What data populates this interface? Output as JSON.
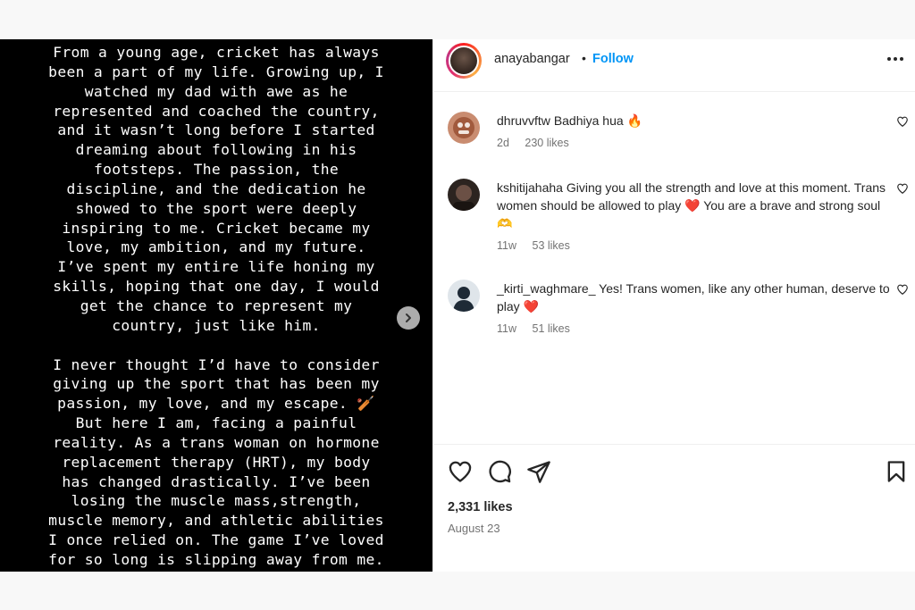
{
  "media": {
    "paragraph1": "From a young age, cricket has always\nbeen a part of my life. Growing up, I\nwatched my dad with awe as he\nrepresented and coached the country,\nand it wasn’t long before I started\ndreaming about following in his\nfootsteps. The passion, the\ndiscipline, and the dedication he\nshowed to the sport were deeply\ninspiring to me. Cricket became my\nlove, my ambition, and my future.\nI’ve spent my entire life honing my\nskills, hoping that one day, I would\nget the chance to represent my\ncountry, just like him.",
    "paragraph2": "I never thought I’d have to consider\ngiving up the sport that has been my\npassion, my love, and my escape. 🏏\nBut here I am, facing a painful\nreality. As a trans woman on hormone\nreplacement therapy (HRT), my body\nhas changed drastically. I’ve been\nlosing the muscle mass,strength,\nmuscle memory, and athletic abilities\nI once relied on. The game I’ve loved\nfor so long is slipping away from me.",
    "next_icon": "chevron-right-icon"
  },
  "header": {
    "username": "anayabangar",
    "separator": "•",
    "follow_label": "Follow",
    "more_icon": "more-horizontal-icon"
  },
  "comments": [
    {
      "username": "dhruvvftw",
      "text": "Badhiya hua 🔥",
      "age": "2d",
      "likes": "230 likes",
      "avatar_color": "#b56a4a"
    },
    {
      "username": "kshitijahaha",
      "text": "Giving you all the strength and love at this moment. Trans women should be allowed to play ❤️ You are a brave and strong soul 🫶",
      "age": "11w",
      "likes": "53 likes",
      "avatar_color": "#3b2f2a"
    },
    {
      "username": "_kirti_waghmare_",
      "text": "Yes! Trans women, like any other human, deserve to play ❤️",
      "age": "11w",
      "likes": "51 likes",
      "avatar_color": "#c9d1d9"
    }
  ],
  "actions": {
    "like_icon": "heart-outline-icon",
    "comment_icon": "comment-icon",
    "share_icon": "paper-plane-icon",
    "save_icon": "bookmark-icon",
    "likes_count": "2,331 likes",
    "date": "August 23"
  },
  "colors": {
    "link_blue": "#0095f6",
    "heart_red": "#ed4956",
    "text_primary": "#262626",
    "text_secondary": "#737373"
  }
}
